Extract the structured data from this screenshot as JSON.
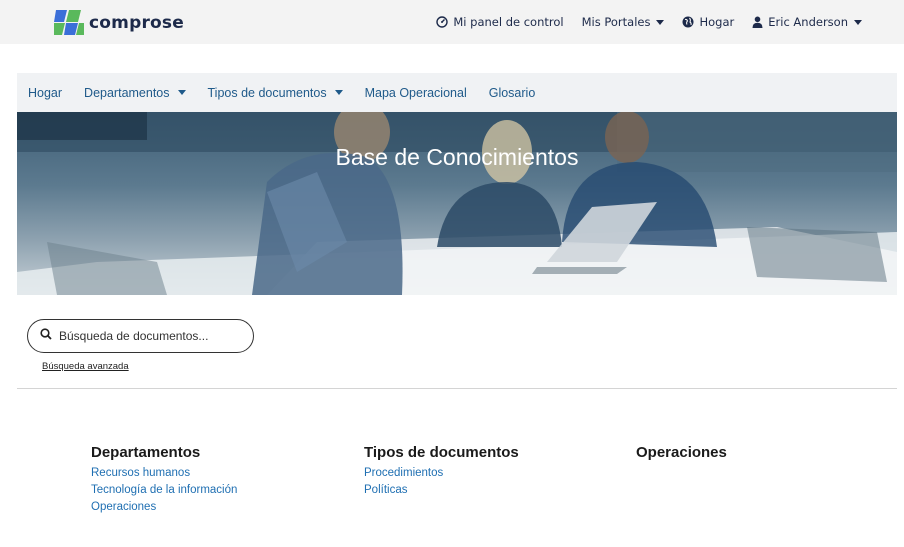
{
  "brand": {
    "name": "comprose",
    "colors": {
      "green": "#5ab95c",
      "blue": "#3b6fd8",
      "navy": "#1d2a4a"
    }
  },
  "topnav": {
    "dashboard": {
      "label": "Mi panel de control",
      "icon": "dashboard-icon"
    },
    "portals": {
      "label": "Mis Portales",
      "icon": "chevron-down-icon"
    },
    "home": {
      "label": "Hogar",
      "icon": "globe-icon"
    },
    "user": {
      "label": "Eric Anderson",
      "icon": "user-icon"
    }
  },
  "mainnav": {
    "items": [
      {
        "label": "Hogar",
        "dropdown": false
      },
      {
        "label": "Departamentos",
        "dropdown": true
      },
      {
        "label": "Tipos de documentos",
        "dropdown": true
      },
      {
        "label": "Mapa Operacional",
        "dropdown": false
      },
      {
        "label": "Glosario",
        "dropdown": false
      }
    ],
    "link_color": "#1f5a8a"
  },
  "hero": {
    "title": "Base de Conocimientos"
  },
  "search": {
    "placeholder": "Búsqueda de documentos...",
    "advanced_label": "Búsqueda avanzada"
  },
  "sections": [
    {
      "title": "Departamentos",
      "links": [
        "Recursos humanos",
        "Tecnología de la información",
        "Operaciones"
      ]
    },
    {
      "title": "Tipos de documentos",
      "links": [
        "Procedimientos",
        "Políticas"
      ]
    },
    {
      "title": "Operaciones",
      "links": []
    }
  ]
}
